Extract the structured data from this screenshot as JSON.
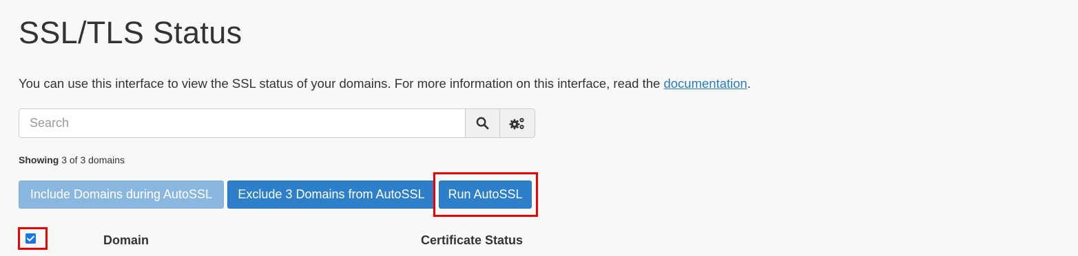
{
  "page": {
    "title": "SSL/TLS Status",
    "intro_text": "You can use this interface to view the SSL status of your domains. For more information on this interface, read the ",
    "doc_link_text": "documentation",
    "intro_end": "."
  },
  "search": {
    "placeholder": "Search",
    "value": "",
    "search_icon": "search-icon",
    "settings_icon": "gears-icon"
  },
  "summary": {
    "label": "Showing",
    "text": "3 of 3 domains"
  },
  "actions": {
    "include_label": "Include Domains during AutoSSL",
    "exclude_label": "Exclude 3 Domains from AutoSSL",
    "run_label": "Run AutoSSL"
  },
  "table": {
    "select_all_checked": true,
    "columns": [
      "Domain",
      "Certificate Status"
    ]
  },
  "colors": {
    "primary": "#2d7fc9",
    "primary_disabled": "#8ab7e0",
    "highlight": "#ee0000",
    "link": "#2b7bb9",
    "checkbox": "#1a73e8"
  }
}
